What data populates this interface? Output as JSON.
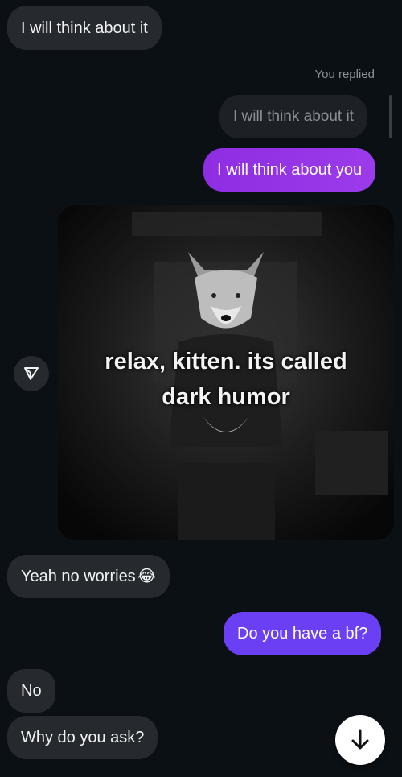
{
  "messages": {
    "m1": "I will think about it",
    "reply_label": "You replied",
    "m2_quoted": "I will think about it",
    "m3": "I will think about you",
    "gif_caption": "relax, kitten. its called\ndark humor",
    "m4_text": "Yeah no worries",
    "m4_emoji": "😂",
    "m5": "Do you have a bf?",
    "m6": "No",
    "m7": "Why do you ask?"
  },
  "colors": {
    "background": "#0b1014",
    "incoming_bubble": "#262a2f",
    "outgoing_gradient": "#8e2de2",
    "outgoing_violet": "#6b3ff4"
  },
  "icons": {
    "share": "send-triangle-icon",
    "scroll_down": "arrow-down-icon"
  }
}
